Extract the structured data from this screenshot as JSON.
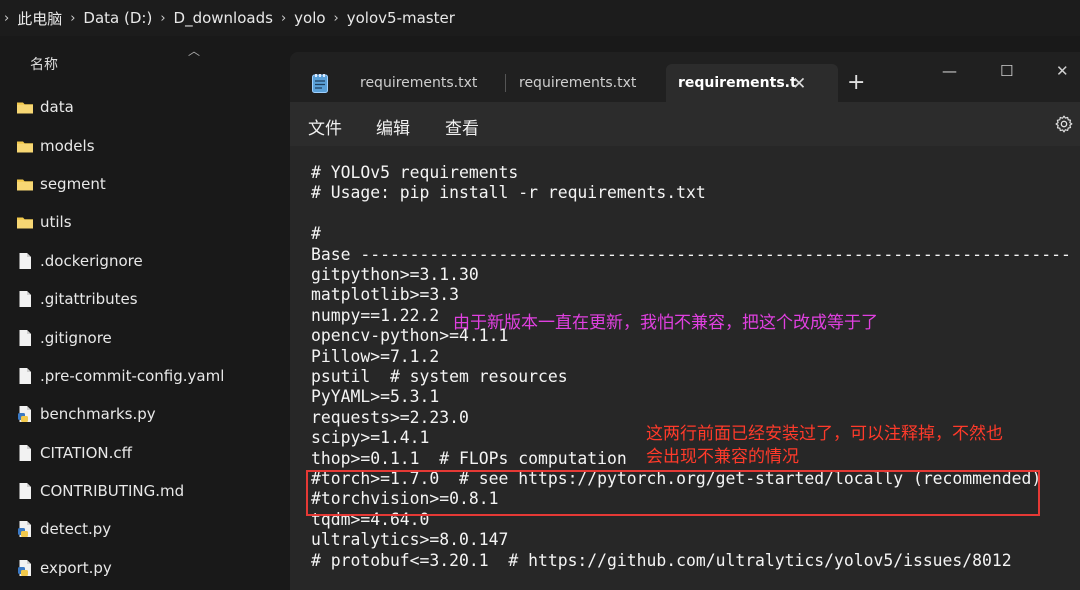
{
  "breadcrumb": {
    "items": [
      "此电脑",
      "Data (D:)",
      "D_downloads",
      "yolo",
      "yolov5-master"
    ]
  },
  "explorer": {
    "column_header": "名称",
    "items": [
      {
        "name": "data",
        "type": "folder"
      },
      {
        "name": "models",
        "type": "folder"
      },
      {
        "name": "segment",
        "type": "folder"
      },
      {
        "name": "utils",
        "type": "folder"
      },
      {
        "name": ".dockerignore",
        "type": "file"
      },
      {
        "name": ".gitattributes",
        "type": "file"
      },
      {
        "name": ".gitignore",
        "type": "file"
      },
      {
        "name": ".pre-commit-config.yaml",
        "type": "file"
      },
      {
        "name": "benchmarks.py",
        "type": "python"
      },
      {
        "name": "CITATION.cff",
        "type": "file"
      },
      {
        "name": "CONTRIBUTING.md",
        "type": "file"
      },
      {
        "name": "detect.py",
        "type": "python"
      },
      {
        "name": "export.py",
        "type": "python"
      }
    ]
  },
  "notepad": {
    "tabs": [
      {
        "label": "requirements.txt",
        "active": false
      },
      {
        "label": "requirements.txt",
        "active": false
      },
      {
        "label": "requirements.t",
        "active": true
      }
    ],
    "menu": {
      "file": "文件",
      "edit": "编辑",
      "view": "查看"
    },
    "lines": [
      "# YOLOv5 requirements",
      "# Usage: pip install -r requirements.txt",
      "",
      "#",
      "Base ------------------------------------------------------------------------",
      "gitpython>=3.1.30",
      "matplotlib>=3.3",
      "numpy==1.22.2",
      "opencv-python>=4.1.1",
      "Pillow>=7.1.2",
      "psutil  # system resources",
      "PyYAML>=5.3.1",
      "requests>=2.23.0",
      "scipy>=1.4.1",
      "thop>=0.1.1  # FLOPs computation",
      "#torch>=1.7.0  # see https://pytorch.org/get-started/locally (recommended)",
      "#torchvision>=0.8.1",
      "tqdm>=4.64.0",
      "ultralytics>=8.0.147",
      "# protobuf<=3.20.1  # https://github.com/ultralytics/yolov5/issues/8012"
    ]
  },
  "annotations": {
    "numpy_note": "由于新版本一直在更新，我怕不兼容，把这个改成等于了",
    "torch_note_line1": "这两行前面已经安装过了，可以注释掉，不然也",
    "torch_note_line2": "会出现不兼容的情况"
  },
  "colors": {
    "annotation_magenta": "#e040e0",
    "annotation_red": "#ff3a2a",
    "highlight_border": "#e53935",
    "folder_yellow": "#f2c94c"
  }
}
